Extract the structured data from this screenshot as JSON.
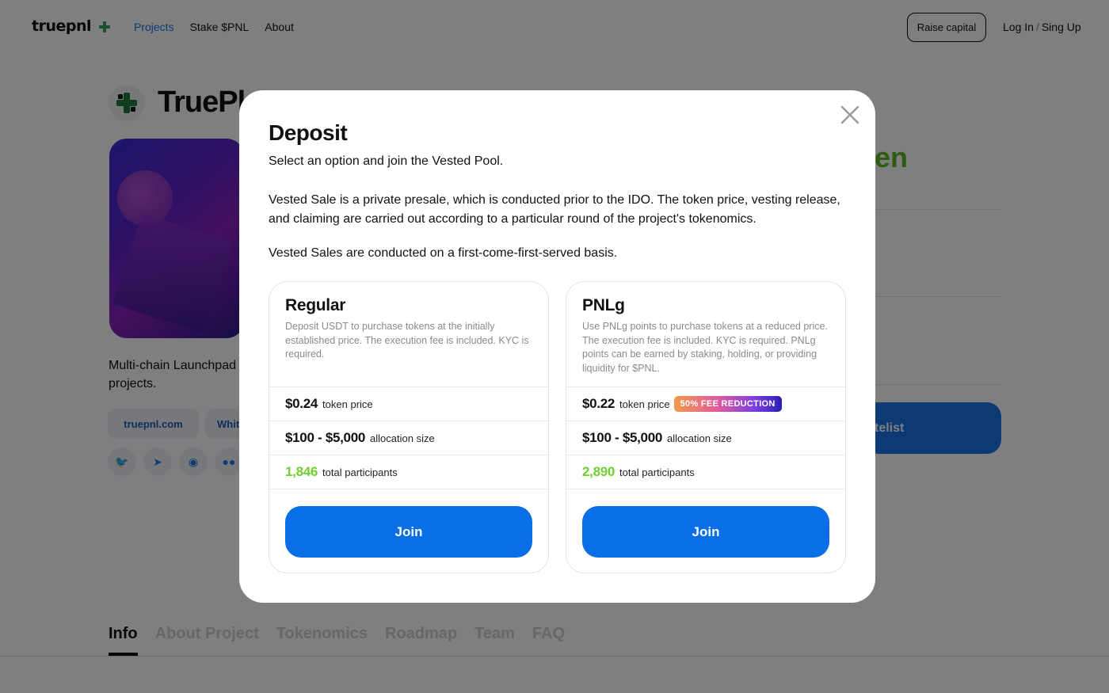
{
  "nav": {
    "logo_text": "truepnl",
    "links": [
      "Projects",
      "Stake $PNL",
      "About"
    ],
    "raise_label": "Raise capital",
    "login_label": "Log In",
    "signup_label": "Sing Up",
    "separator": "/"
  },
  "project": {
    "title": "TruePl",
    "description_line1": "Multi-chain Launchpad",
    "description_line2": "projects.",
    "chips": [
      "truepnl.com",
      "Whit"
    ],
    "status_fragment": "en",
    "whitelist_fragment": "telist"
  },
  "tabs": [
    "Info",
    "About Project",
    "Tokenomics",
    "Roadmap",
    "Team",
    "FAQ"
  ],
  "modal": {
    "title": "Deposit",
    "subtitle": "Select an option and join the Vested Pool.",
    "body1": "Vested Sale is a private presale, which is conducted prior to the IDO. The token price, vesting release, and claiming are carried out according to a particular round of the project's tokenomics.",
    "body2": "Vested Sales are conducted on a first-come-first-served basis.",
    "options": [
      {
        "title": "Regular",
        "description": "Deposit USDT to purchase tokens at the initially established price. The execution fee is included. KYC is required.",
        "price": "$0.24",
        "price_label": "token price",
        "allocation": "$100 - $5,000",
        "allocation_label": "allocation size",
        "participants": "1,846",
        "participants_label": "total participants",
        "join_label": "Join"
      },
      {
        "title": "PNLg",
        "description": "Use PNLg points to purchase tokens at a reduced price. The execution fee is included. KYC is required. PNLg points can be earned by staking, holding, or providing liquidity for $PNL.",
        "price": "$0.22",
        "price_label": "token price",
        "badge": "50% FEE REDUCTION",
        "allocation": "$100 - $5,000",
        "allocation_label": "allocation size",
        "participants": "2,890",
        "participants_label": "total participants",
        "join_label": "Join"
      }
    ]
  },
  "colors": {
    "accent": "#0a6fe6",
    "green": "#6fcf2f",
    "overlay": "rgba(0,0,0,0.5)"
  }
}
